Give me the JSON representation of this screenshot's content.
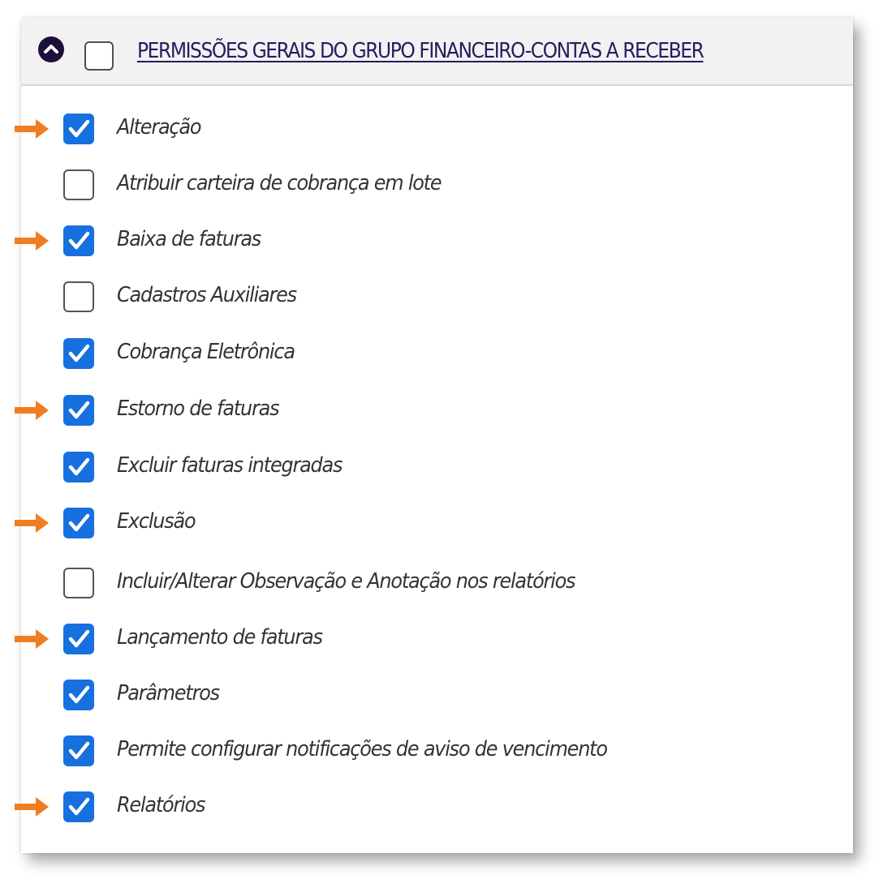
{
  "header": {
    "title": "PERMISSÕES GERAIS DO GRUPO FINANCEIRO-CONTAS A RECEBER",
    "collapse_icon": "chevron-up-circle-icon",
    "checked": false
  },
  "colors": {
    "checkbox_checked": "#1670e0",
    "arrow": "#ef7d22",
    "title": "#2a1a5e",
    "collapse_button": "#1d0f3a"
  },
  "permissions": [
    {
      "label": "Alteração",
      "checked": true,
      "highlighted": true
    },
    {
      "label": "Atribuir carteira de cobrança em lote",
      "checked": false,
      "highlighted": false
    },
    {
      "label": "Baixa de faturas",
      "checked": true,
      "highlighted": true
    },
    {
      "label": "Cadastros Auxiliares",
      "checked": false,
      "highlighted": false
    },
    {
      "label": "Cobrança Eletrônica",
      "checked": true,
      "highlighted": false
    },
    {
      "label": "Estorno de faturas",
      "checked": true,
      "highlighted": true
    },
    {
      "label": "Excluir faturas integradas",
      "checked": true,
      "highlighted": false
    },
    {
      "label": "Exclusão",
      "checked": true,
      "highlighted": true
    },
    {
      "label": "Incluir/Alterar Observação e Anotação nos relatórios",
      "checked": false,
      "highlighted": false
    },
    {
      "label": "Lançamento de faturas",
      "checked": true,
      "highlighted": true
    },
    {
      "label": "Parâmetros",
      "checked": true,
      "highlighted": false
    },
    {
      "label": "Permite configurar notificações de aviso de vencimento",
      "checked": true,
      "highlighted": false
    },
    {
      "label": "Relatórios",
      "checked": true,
      "highlighted": true
    }
  ]
}
